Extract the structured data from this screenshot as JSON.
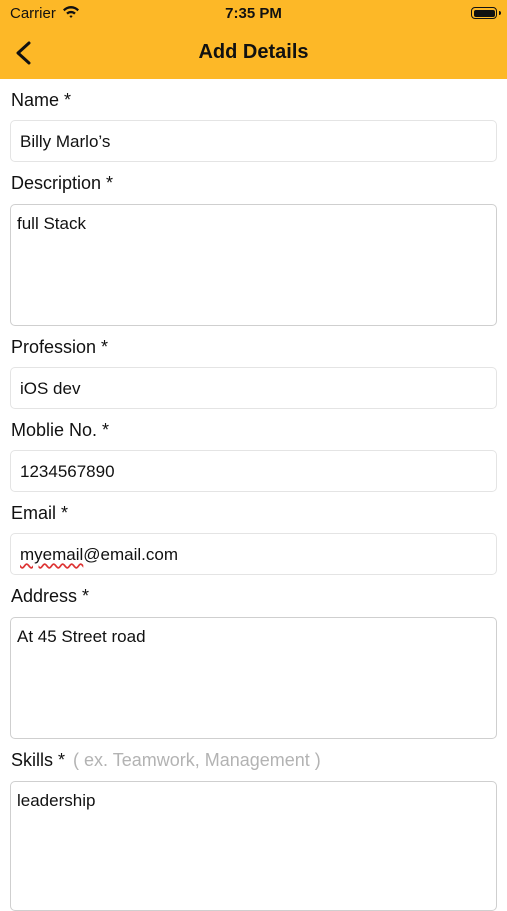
{
  "status_bar": {
    "carrier": "Carrier",
    "time": "7:35 PM"
  },
  "nav": {
    "title": "Add Details"
  },
  "form": {
    "name": {
      "label": "Name *",
      "value": "Billy Marlo’s"
    },
    "description": {
      "label": "Description *",
      "value": "full Stack"
    },
    "profession": {
      "label": "Profession *",
      "value": "iOS dev"
    },
    "mobile": {
      "label": "Moblie No. *",
      "value": "1234567890"
    },
    "email": {
      "label": "Email *",
      "value_prefix": "myemail",
      "value_rest": "@email.com"
    },
    "address": {
      "label": "Address *",
      "value": "At 45 Street road"
    },
    "skills": {
      "label": "Skills *",
      "hint": "( ex. Teamwork, Management )",
      "value": "leadership"
    }
  },
  "colors": {
    "header": "#FDB827",
    "spellcheck": "#DD3333"
  }
}
